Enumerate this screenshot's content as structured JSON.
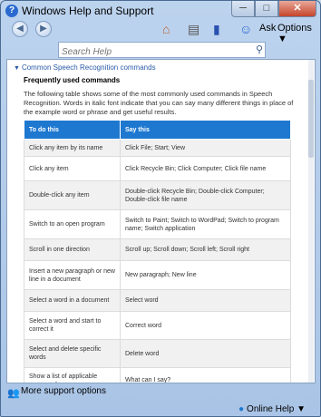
{
  "window": {
    "title": "Windows Help and Support",
    "min": "─",
    "max": "□",
    "close": "✕"
  },
  "toolbar": {
    "back": "◀",
    "forward": "▶",
    "ask": "Ask",
    "options": "Options ▼"
  },
  "search": {
    "placeholder": "Search Help",
    "value": ""
  },
  "content": {
    "section_title": "Common Speech Recognition commands",
    "subheading": "Frequently used commands",
    "intro": "The following table shows some of the most commonly used commands in Speech Recognition. Words in italic font indicate that you can say many different things in place of the example word or phrase and get useful results.",
    "table": {
      "headers": [
        "To do this",
        "Say this"
      ],
      "rows": [
        {
          "do": "Click any item by its name",
          "say": "Click File; Start; View"
        },
        {
          "do": "Click any item",
          "say": "Click Recycle Bin; Click Computer; Click file name"
        },
        {
          "do": "Double-click any item",
          "say": "Double-click Recycle Bin; Double-click Computer; Double-click file name"
        },
        {
          "do": "Switch to an open program",
          "say": "Switch to Paint; Switch to WordPad; Switch to program name; Switch application"
        },
        {
          "do": "Scroll in one direction",
          "say": "Scroll up; Scroll down; Scroll left; Scroll right"
        },
        {
          "do": "Insert a new paragraph or new line in a document",
          "say": "New paragraph; New line"
        },
        {
          "do": "Select a word in a document",
          "say": "Select word"
        },
        {
          "do": "Select a word and start to correct it",
          "say": "Correct word"
        },
        {
          "do": "Select and delete specific words",
          "say": "Delete word"
        },
        {
          "do": "Show a list of applicable commands",
          "say": "What can I say?"
        }
      ]
    }
  },
  "status": {
    "more_support": "More support options",
    "online_help": "Online Help ▼"
  }
}
